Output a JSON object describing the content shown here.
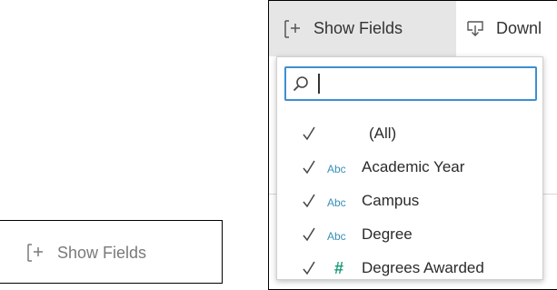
{
  "left_button": {
    "label": "Show Fields",
    "icon": "add-column-icon"
  },
  "toolbar": {
    "show_fields_label": "Show Fields",
    "download_label": "Downl",
    "show_fields_icon": "add-column-icon",
    "download_icon": "download-icon"
  },
  "dropdown": {
    "search": {
      "value": "",
      "placeholder": ""
    },
    "fields": [
      {
        "label": "(All)",
        "type": "",
        "checked": true
      },
      {
        "label": "Academic Year",
        "type": "Abc",
        "checked": true
      },
      {
        "label": "Campus",
        "type": "Abc",
        "checked": true
      },
      {
        "label": "Degree",
        "type": "Abc",
        "checked": true
      },
      {
        "label": "Degrees Awarded",
        "type": "#",
        "checked": true
      }
    ]
  },
  "colors": {
    "focus_border": "#3d8fd1",
    "abc_type": "#3a8fb7",
    "number_type": "#1c9a77",
    "toolbar_active_bg": "#e6e6e6"
  }
}
